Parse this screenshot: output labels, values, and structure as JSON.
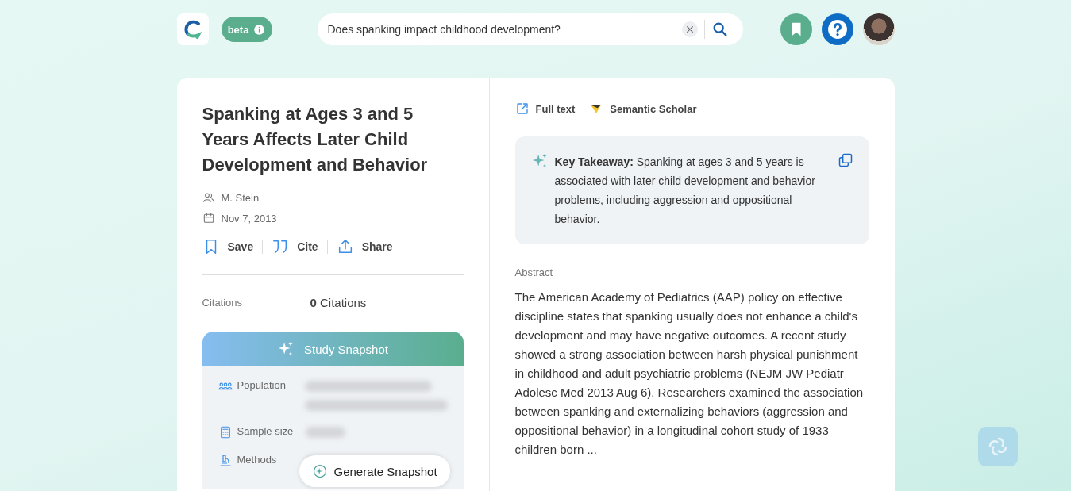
{
  "header": {
    "badge": "beta",
    "search": {
      "value": "Does spanking impact childhood development?"
    }
  },
  "paper": {
    "title": "Spanking at Ages 3 and 5 Years Affects Later Child Development and Behavior",
    "author": "M. Stein",
    "date": "Nov 7, 2013",
    "actions": [
      {
        "kind": "save",
        "label": "Save"
      },
      {
        "kind": "cite",
        "label": "Cite"
      },
      {
        "kind": "share",
        "label": "Share"
      }
    ],
    "citations": {
      "label": "Citations",
      "count": "0",
      "unit": "Citations"
    },
    "snapshot": {
      "title": "Study Snapshot",
      "rows": [
        {
          "kind": "population",
          "label": "Population"
        },
        {
          "kind": "sample",
          "label": "Sample size"
        },
        {
          "kind": "methods",
          "label": "Methods"
        }
      ],
      "button": "Generate Snapshot"
    }
  },
  "links": [
    {
      "kind": "fulltext",
      "label": "Full text"
    },
    {
      "kind": "scholar",
      "label": "Semantic Scholar"
    }
  ],
  "takeaway": "**Key Takeaway:** Spanking at ages 3 and 5 years is associated with later child development and behavior problems, including aggression and oppositional behavior.",
  "abstract": {
    "heading": "Abstract",
    "text": "The American Academy of Pediatrics (AAP) policy on effective discipline states that spanking usually does not enhance a child's development and may have negative outcomes. A recent study showed a strong association between harsh physical punishment in childhood and adult psychiatric problems (NEJM JW Pediatr Adolesc Med 2013 Aug 6). Researchers examined the association between spanking and externalizing behaviors (aggression and oppositional behavior) in a longitudinal cohort study of 1933 children born ..."
  }
}
